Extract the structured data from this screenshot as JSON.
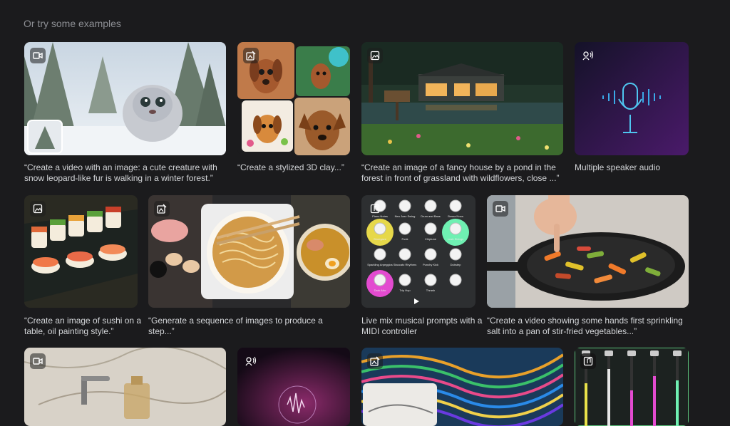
{
  "heading": "Or try some examples",
  "cards": [
    {
      "caption": "“Create a video with an image: a cute creature with snow leopard-like fur is walking in a winter forest.”",
      "type_icon": "video-icon"
    },
    {
      "caption": "“Create a stylized 3D clay...”",
      "type_icon": "edit-image-icon"
    },
    {
      "caption": "“Create an image of a fancy house by a pond in the forest in front of grassland with wildflowers, close ...”",
      "type_icon": "image-icon"
    },
    {
      "caption": "Multiple speaker audio",
      "type_icon": "speech-icon"
    },
    {
      "caption": "“Create an image of sushi on a table, oil painting style.”",
      "type_icon": "image-icon"
    },
    {
      "caption": "“Generate a sequence of images to produce a step...”",
      "type_icon": "edit-image-icon"
    },
    {
      "caption": "Live mix musical prompts with a MIDI controller",
      "type_icon": "music-icon"
    },
    {
      "caption": "“Create a video showing some hands first sprinkling salt into a pan of stir-fried vegetables...”",
      "type_icon": "video-icon"
    },
    {
      "caption": "",
      "type_icon": "video-icon"
    },
    {
      "caption": "",
      "type_icon": "speech-icon"
    },
    {
      "caption": "",
      "type_icon": "edit-image-icon"
    },
    {
      "caption": "",
      "type_icon": "music-icon"
    }
  ],
  "midi": {
    "knob_labels": [
      "Piano Notes",
      "Neo Jazz Swing",
      "Drum and Bass",
      "Bossa Nova",
      "Shoegaze",
      "Funk",
      "Chiptune",
      "Lush Strings",
      "Sparkling Arpeggios",
      "Staccato Rhythms",
      "Punchy Kick",
      "Dubstep",
      "Dark Afro",
      "Trip Hop",
      "Thrash"
    ]
  },
  "colors": {
    "background": "#1b1b1d",
    "heading": "#8d8f94",
    "caption": "#d3d5d8"
  }
}
